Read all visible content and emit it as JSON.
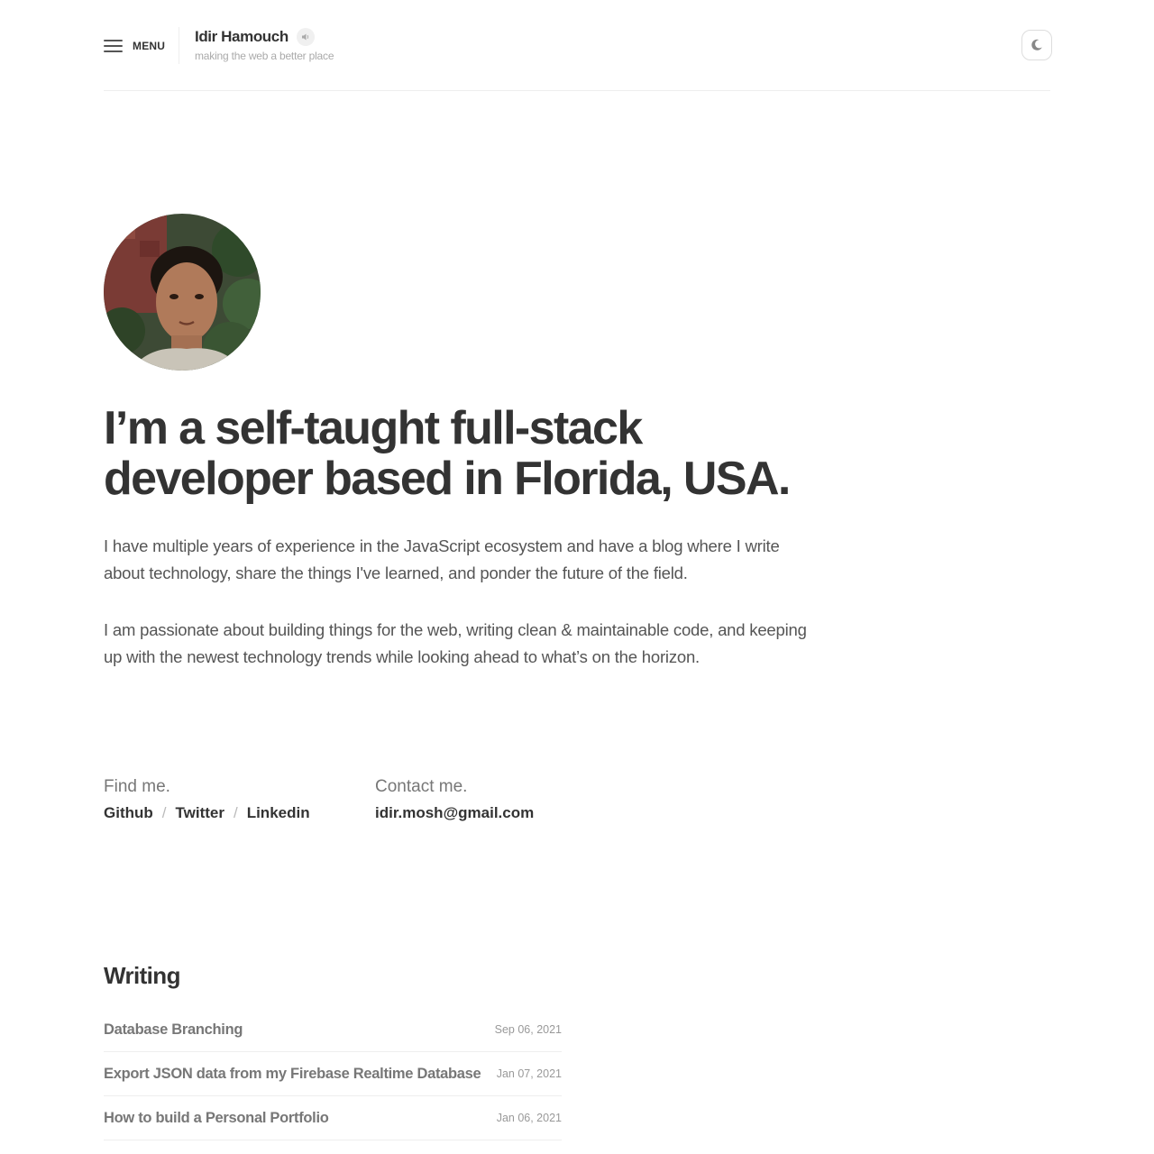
{
  "header": {
    "menu_label": "MENU",
    "brand_name": "Idir Hamouch",
    "tagline": "making the web a better place",
    "speaker_icon": "speaker-icon",
    "theme_icon": "moon-icon"
  },
  "hero": {
    "avatar": "profile-photo",
    "title_line1": "I’m a self-taught full-stack",
    "title_line2": "developer based in Florida, USA.",
    "para1": "I have multiple years of experience in the JavaScript ecosystem and have a blog where I write about technology, share the things I've learned, and ponder the future of the field.",
    "para2": "I am passionate about building things for the web, writing clean & maintainable code, and keeping up with the newest technology trends while looking ahead to what’s on the horizon."
  },
  "find": {
    "label": "Find me.",
    "links": [
      "Github",
      "Twitter",
      "Linkedin"
    ],
    "separator": "/"
  },
  "contact": {
    "label": "Contact me.",
    "email": "idir.mosh@gmail.com"
  },
  "writing": {
    "title": "Writing",
    "posts": [
      {
        "title": "Database Branching",
        "date": "Sep 06, 2021"
      },
      {
        "title": "Export JSON data from my Firebase Realtime Database",
        "date": "Jan 07, 2021"
      },
      {
        "title": "How to build a Personal Portfolio",
        "date": "Jan 06, 2021"
      }
    ]
  },
  "colors": {
    "text": "#333333",
    "muted": "#777777",
    "border": "#eeeeee"
  }
}
